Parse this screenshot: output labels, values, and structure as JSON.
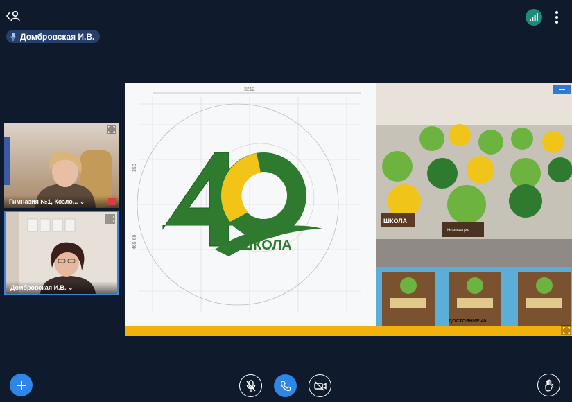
{
  "header": {
    "back_icon": "back-user-icon",
    "speaker": {
      "name": "Домбровская И.В.",
      "icon": "microphone-icon"
    },
    "signal_icon": "signal-bars-icon",
    "signal_color": "#1f8a7a",
    "more_icon": "vertical-dots-icon"
  },
  "participants": [
    {
      "label": "Гимназия №1, Козло...",
      "muted": true
    },
    {
      "label": "Домбровская И.В.",
      "active": true
    }
  ],
  "shared_screen": {
    "logo_number": "40",
    "logo_text": "ШКОЛА",
    "dimension_top": "3212",
    "dimension_side": "350",
    "dimension_side2": "465,68",
    "award_text": "ШКОЛА",
    "plaque_text": "ДОСТОЯНИЕ 40",
    "award_caption": "Номинация"
  },
  "controls": {
    "add_icon": "plus-icon",
    "mic_icon": "mic-off-icon",
    "call_icon": "phone-icon",
    "camera_icon": "camera-off-icon",
    "hand_icon": "raise-hand-icon",
    "accent": "#2e86e6"
  }
}
